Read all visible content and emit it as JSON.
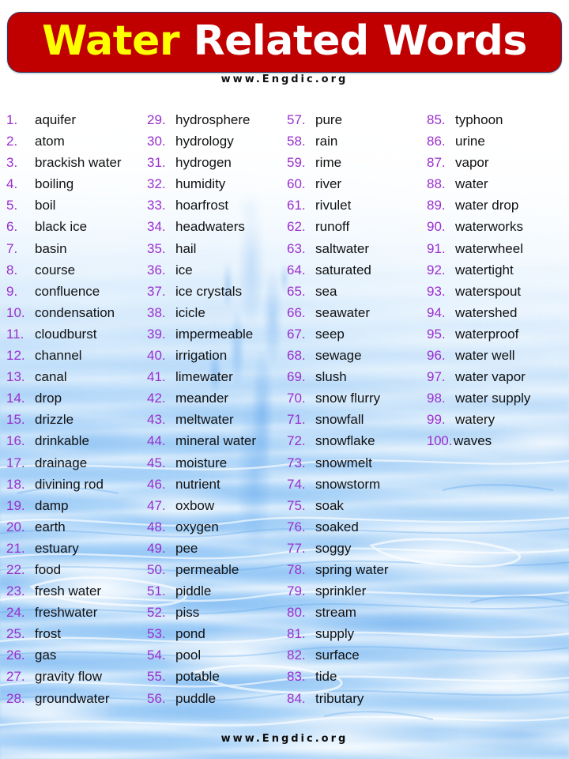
{
  "header": {
    "title_part1": "Water",
    "title_part2": "Related Words",
    "site": "www.Engdic.org",
    "banner_color": "#C00000",
    "title_color_1": "#FFFF00",
    "title_color_2": "#FFFFFF",
    "border_color": "#2F3A6B"
  },
  "footer": {
    "site": "www.Engdic.org"
  },
  "list": {
    "number_color": "#9A2ECE",
    "word_color": "#121212",
    "total": 100,
    "columns": [
      {
        "items": [
          {
            "num": "1.",
            "word": "aquifer"
          },
          {
            "num": "2.",
            "word": "atom"
          },
          {
            "num": "3.",
            "word": "brackish water"
          },
          {
            "num": "4.",
            "word": "boiling"
          },
          {
            "num": "5.",
            "word": "boil"
          },
          {
            "num": "6.",
            "word": "black ice"
          },
          {
            "num": "7.",
            "word": "basin"
          },
          {
            "num": "8.",
            "word": "course"
          },
          {
            "num": "9.",
            "word": "confluence"
          },
          {
            "num": "10.",
            "word": "condensation"
          },
          {
            "num": "11.",
            "word": "cloudburst"
          },
          {
            "num": "12.",
            "word": "channel"
          },
          {
            "num": "13.",
            "word": "canal"
          },
          {
            "num": "14.",
            "word": "drop"
          },
          {
            "num": "15.",
            "word": "drizzle"
          },
          {
            "num": "16.",
            "word": "drinkable"
          },
          {
            "num": "17.",
            "word": "drainage"
          },
          {
            "num": "18.",
            "word": "divining rod"
          },
          {
            "num": "19.",
            "word": "damp"
          },
          {
            "num": "20.",
            "word": "earth"
          },
          {
            "num": "21.",
            "word": "estuary"
          },
          {
            "num": "22.",
            "word": "food"
          },
          {
            "num": "23.",
            "word": "fresh water"
          },
          {
            "num": "24.",
            "word": "freshwater"
          },
          {
            "num": "25.",
            "word": "frost"
          },
          {
            "num": "26.",
            "word": "gas"
          },
          {
            "num": "27.",
            "word": "gravity flow"
          },
          {
            "num": "28.",
            "word": "groundwater"
          }
        ]
      },
      {
        "items": [
          {
            "num": "29.",
            "word": "hydrosphere"
          },
          {
            "num": "30.",
            "word": "hydrology"
          },
          {
            "num": "31.",
            "word": "hydrogen"
          },
          {
            "num": "32.",
            "word": "humidity"
          },
          {
            "num": "33.",
            "word": "hoarfrost"
          },
          {
            "num": "34.",
            "word": "headwaters"
          },
          {
            "num": "35.",
            "word": "hail"
          },
          {
            "num": "36.",
            "word": "ice"
          },
          {
            "num": "37.",
            "word": "ice crystals"
          },
          {
            "num": "38.",
            "word": "icicle"
          },
          {
            "num": "39.",
            "word": "impermeable"
          },
          {
            "num": "40.",
            "word": "irrigation"
          },
          {
            "num": "41.",
            "word": "limewater"
          },
          {
            "num": "42.",
            "word": "meander"
          },
          {
            "num": "43.",
            "word": "meltwater"
          },
          {
            "num": "44.",
            "word": "mineral water"
          },
          {
            "num": "45.",
            "word": "moisture"
          },
          {
            "num": "46.",
            "word": "nutrient"
          },
          {
            "num": "47.",
            "word": "oxbow"
          },
          {
            "num": "48.",
            "word": "oxygen"
          },
          {
            "num": "49.",
            "word": "pee"
          },
          {
            "num": "50.",
            "word": "permeable"
          },
          {
            "num": "51.",
            "word": "piddle"
          },
          {
            "num": "52.",
            "word": "piss"
          },
          {
            "num": "53.",
            "word": "pond"
          },
          {
            "num": "54.",
            "word": "pool"
          },
          {
            "num": "55.",
            "word": "potable"
          },
          {
            "num": "56.",
            "word": "puddle"
          }
        ]
      },
      {
        "items": [
          {
            "num": "57.",
            "word": "pure"
          },
          {
            "num": "58.",
            "word": "rain"
          },
          {
            "num": "59.",
            "word": "rime"
          },
          {
            "num": "60.",
            "word": "river"
          },
          {
            "num": "61.",
            "word": "rivulet"
          },
          {
            "num": "62.",
            "word": "runoff"
          },
          {
            "num": "63.",
            "word": "saltwater"
          },
          {
            "num": "64.",
            "word": "saturated"
          },
          {
            "num": "65.",
            "word": "sea"
          },
          {
            "num": "66.",
            "word": "seawater"
          },
          {
            "num": "67.",
            "word": "seep"
          },
          {
            "num": "68.",
            "word": "sewage"
          },
          {
            "num": "69.",
            "word": "slush"
          },
          {
            "num": "70.",
            "word": "snow flurry"
          },
          {
            "num": "71.",
            "word": "snowfall"
          },
          {
            "num": "72.",
            "word": "snowflake"
          },
          {
            "num": "73.",
            "word": "snowmelt"
          },
          {
            "num": "74.",
            "word": "snowstorm"
          },
          {
            "num": "75.",
            "word": "soak"
          },
          {
            "num": "76.",
            "word": "soaked"
          },
          {
            "num": "77.",
            "word": "soggy"
          },
          {
            "num": "78.",
            "word": "spring water"
          },
          {
            "num": "79.",
            "word": "sprinkler"
          },
          {
            "num": "80.",
            "word": "stream"
          },
          {
            "num": "81.",
            "word": "supply"
          },
          {
            "num": "82.",
            "word": "surface"
          },
          {
            "num": "83.",
            "word": "tide"
          },
          {
            "num": "84.",
            "word": "tributary"
          }
        ]
      },
      {
        "items": [
          {
            "num": "85.",
            "word": "typhoon"
          },
          {
            "num": "86.",
            "word": "urine"
          },
          {
            "num": "87.",
            "word": "vapor"
          },
          {
            "num": "88.",
            "word": "water"
          },
          {
            "num": "89.",
            "word": "water drop"
          },
          {
            "num": "90.",
            "word": "waterworks"
          },
          {
            "num": "91.",
            "word": "waterwheel"
          },
          {
            "num": "92.",
            "word": "watertight"
          },
          {
            "num": "93.",
            "word": "waterspout"
          },
          {
            "num": "94.",
            "word": "watershed"
          },
          {
            "num": "95.",
            "word": "waterproof"
          },
          {
            "num": "96.",
            "word": "water well"
          },
          {
            "num": "97.",
            "word": "water vapor"
          },
          {
            "num": "98.",
            "word": "water supply"
          },
          {
            "num": "99.",
            "word": "watery"
          },
          {
            "num": "100.",
            "word": "waves"
          }
        ]
      }
    ]
  }
}
